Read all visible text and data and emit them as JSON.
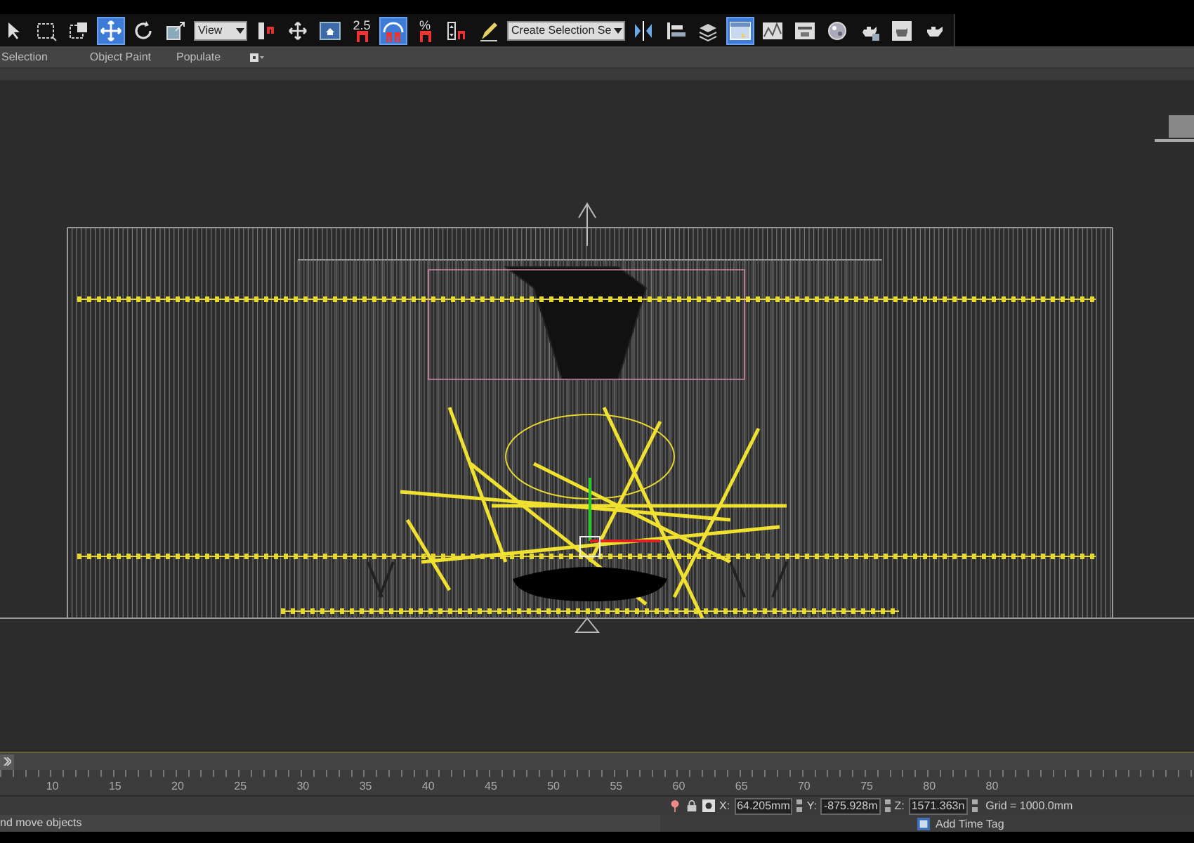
{
  "toolbar": {
    "items": [
      {
        "kind": "tool",
        "selected": false
      },
      {
        "kind": "tool",
        "selected": false
      },
      {
        "kind": "tool",
        "selected": false
      },
      {
        "kind": "tool",
        "selected": true
      },
      {
        "kind": "tool",
        "selected": false
      },
      {
        "kind": "tool",
        "selected": false
      },
      {
        "kind": "dropdown",
        "value": "View"
      },
      {
        "kind": "tool",
        "selected": false
      },
      {
        "kind": "tool",
        "selected": false
      },
      {
        "kind": "tool",
        "selected": false
      },
      {
        "kind": "snap",
        "label": "2.5",
        "selected": false
      },
      {
        "kind": "tool",
        "selected": true
      },
      {
        "kind": "snap",
        "label": "%",
        "selected": false
      },
      {
        "kind": "tool",
        "selected": false
      },
      {
        "kind": "tool",
        "selected": false
      },
      {
        "kind": "dropdown",
        "value": "Create Selection Se"
      },
      {
        "kind": "tool",
        "selected": false
      },
      {
        "kind": "tool",
        "selected": false
      },
      {
        "kind": "tool",
        "selected": false
      },
      {
        "kind": "tool",
        "selected": true
      },
      {
        "kind": "tool",
        "selected": false
      },
      {
        "kind": "tool",
        "selected": false
      },
      {
        "kind": "tool",
        "selected": false
      },
      {
        "kind": "tool",
        "selected": false
      },
      {
        "kind": "tool",
        "selected": false
      },
      {
        "kind": "tool",
        "selected": false
      }
    ]
  },
  "ribbon": {
    "tabs": [
      {
        "label": "Selection"
      },
      {
        "label": "Object Paint"
      },
      {
        "label": "Populate"
      }
    ]
  },
  "timeline": {
    "ticks": [
      "10",
      "15",
      "20",
      "25",
      "30",
      "35",
      "40",
      "45",
      "50",
      "55",
      "60",
      "65",
      "70",
      "75",
      "80",
      "80"
    ]
  },
  "status": {
    "prompt": "nd move objects",
    "coords": [
      {
        "label": "X:",
        "value": "64.205mm"
      },
      {
        "label": "Y:",
        "value": "-875.928m"
      },
      {
        "label": "Z:",
        "value": "1571.363n"
      }
    ],
    "grid": "Grid = 1000.0mm",
    "time_tag": "Add Time Tag"
  }
}
